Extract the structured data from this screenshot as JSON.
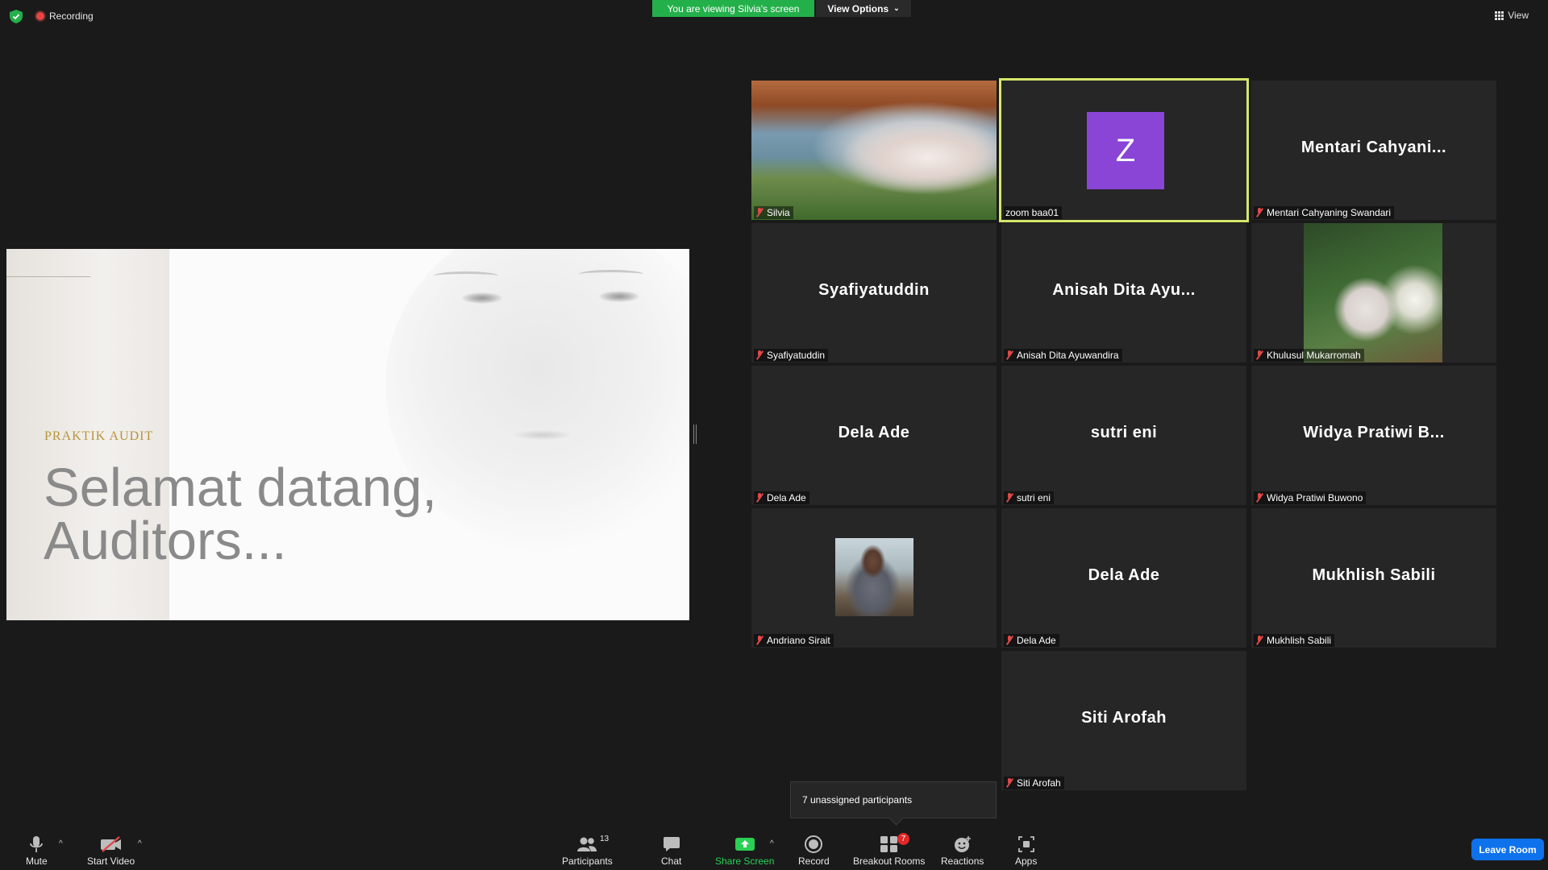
{
  "top": {
    "recording_label": "Recording",
    "viewing_banner": "You are viewing Silvia's screen",
    "view_options_label": "View Options",
    "view_label": "View"
  },
  "slide": {
    "kicker": "PRAKTIK AUDIT",
    "title_line1": "Selamat datang,",
    "title_line2": "Auditors..."
  },
  "participants": [
    {
      "display": "",
      "label": "Silvia",
      "type": "video"
    },
    {
      "display": "Z",
      "label": "zoom baa01",
      "type": "avatar",
      "active": true
    },
    {
      "display": "Mentari  Cahyani...",
      "label": "Mentari Cahyaning Swandari",
      "type": "name"
    },
    {
      "display": "Syafiyatuddin",
      "label": "Syafiyatuddin",
      "type": "name"
    },
    {
      "display": "Anisah  Dita  Ayu...",
      "label": "Anisah Dita Ayuwandira",
      "type": "name"
    },
    {
      "display": "",
      "label": "Khulusul Mukarromah",
      "type": "video"
    },
    {
      "display": "Dela Ade",
      "label": "Dela Ade",
      "type": "name"
    },
    {
      "display": "sutri eni",
      "label": "sutri eni",
      "type": "name"
    },
    {
      "display": "Widya  Pratiwi  B...",
      "label": "Widya Pratiwi Buwono",
      "type": "name"
    },
    {
      "display": "",
      "label": "Andriano Sirait",
      "type": "photo"
    },
    {
      "display": "Dela Ade",
      "label": "Dela Ade",
      "type": "name"
    },
    {
      "display": "Mukhlish Sabili",
      "label": "Mukhlish Sabili",
      "type": "name"
    },
    {
      "display": "Siti Arofah",
      "label": "Siti Arofah",
      "type": "name"
    }
  ],
  "popup": {
    "unassigned": "7 unassigned participants"
  },
  "toolbar": {
    "mute": "Mute",
    "start_video": "Start Video",
    "participants": "Participants",
    "participants_count": "13",
    "chat": "Chat",
    "share_screen": "Share Screen",
    "record": "Record",
    "breakout_rooms": "Breakout Rooms",
    "breakout_badge": "7",
    "reactions": "Reactions",
    "apps": "Apps",
    "leave_room": "Leave Room"
  },
  "colors": {
    "active_speaker_border": "#d6e66a",
    "share_green": "#2ad054",
    "banner_green": "#23b04a",
    "leave_blue": "#0e72ed",
    "avatar_purple": "#8a45d6",
    "muted_red": "#e04848"
  }
}
